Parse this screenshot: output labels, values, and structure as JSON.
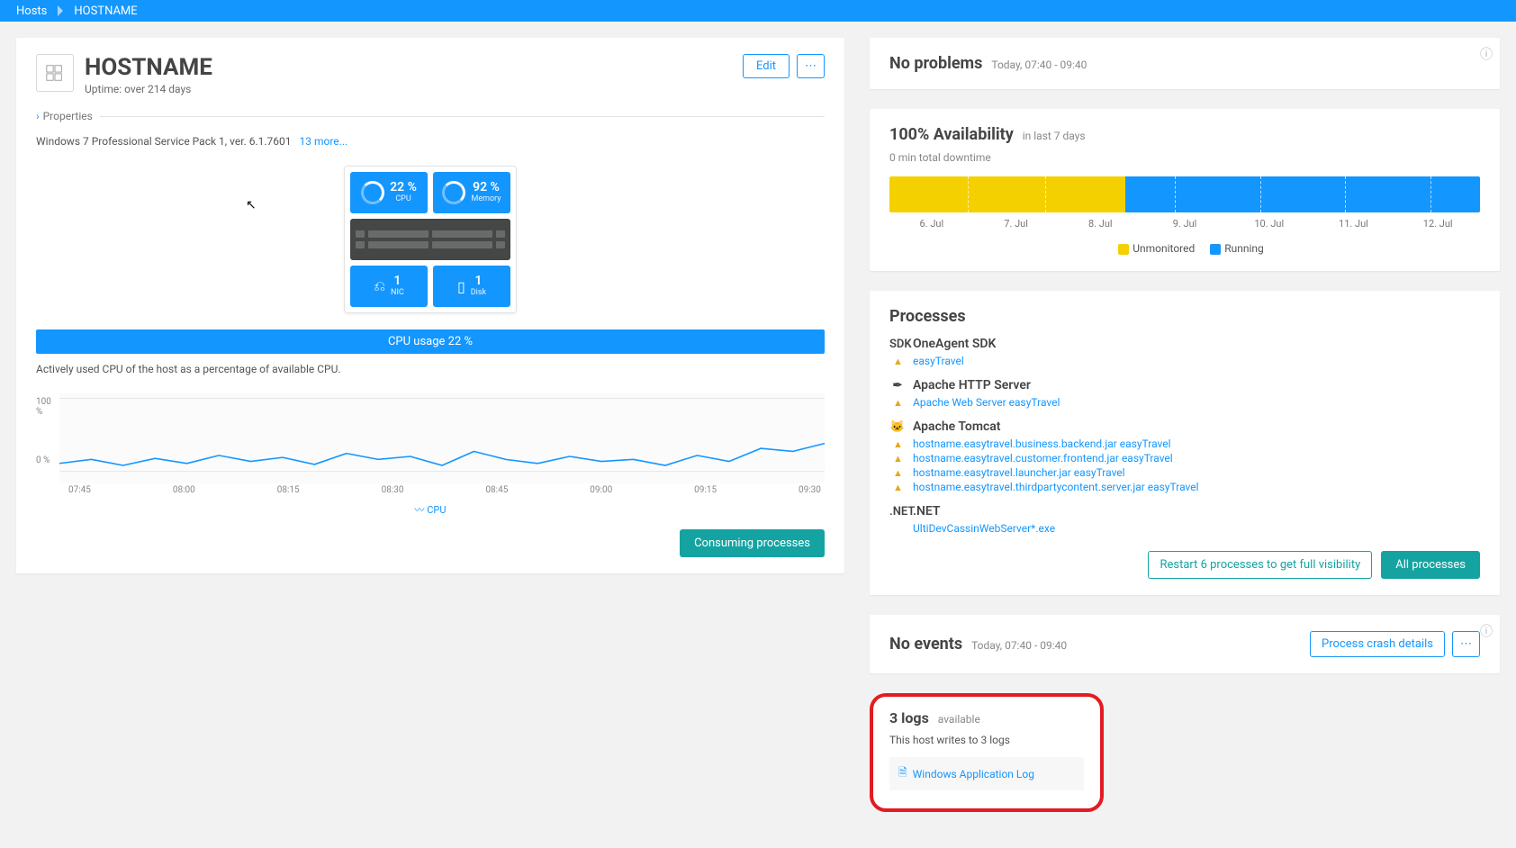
{
  "breadcrumb": {
    "root": "Hosts",
    "current": "HOSTNAME"
  },
  "host": {
    "name": "HOSTNAME",
    "uptime": "Uptime: over 214 days",
    "edit": "Edit",
    "more": "⋯",
    "properties_label": "Properties",
    "os": "Windows 7 Professional Service Pack 1, ver. 6.1.7601",
    "os_more": "13 more..."
  },
  "tiles": {
    "cpu_val": "22 %",
    "cpu_lab": "CPU",
    "mem_val": "92 %",
    "mem_lab": "Memory",
    "nic_val": "1",
    "nic_lab": "NIC",
    "disk_val": "1",
    "disk_lab": "Disk"
  },
  "cpu_panel": {
    "bar": "CPU usage 22 %",
    "desc": "Actively used CPU of the host as a percentage of available CPU.",
    "y100": "100 %",
    "y0": "0 %",
    "legend": "CPU",
    "button": "Consuming processes",
    "xticks": [
      "07:45",
      "08:00",
      "08:15",
      "08:30",
      "08:45",
      "09:00",
      "09:15",
      "09:30"
    ]
  },
  "problems": {
    "title": "No problems",
    "range": "Today, 07:40 - 09:40"
  },
  "availability": {
    "title": "100% Availability",
    "range": "in last 7 days",
    "downtime": "0 min total downtime",
    "dates": [
      "6. Jul",
      "7. Jul",
      "8. Jul",
      "9. Jul",
      "10. Jul",
      "11. Jul",
      "12. Jul"
    ],
    "legend_unmon": "Unmonitored",
    "legend_run": "Running"
  },
  "processes": {
    "title": "Processes",
    "groups": [
      {
        "icon": "SDK",
        "name": "OneAgent SDK",
        "items": [
          {
            "warn": true,
            "label": "easyTravel"
          }
        ]
      },
      {
        "icon": "✒",
        "name": "Apache HTTP Server",
        "items": [
          {
            "warn": true,
            "label": "Apache Web Server easyTravel"
          }
        ]
      },
      {
        "icon": "🐱",
        "name": "Apache Tomcat",
        "items": [
          {
            "warn": true,
            "label": "hostname.easytravel.business.backend.jar easyTravel"
          },
          {
            "warn": true,
            "label": "hostname.easytravel.customer.frontend.jar easyTravel"
          },
          {
            "warn": true,
            "label": "hostname.easytravel.launcher.jar easyTravel"
          },
          {
            "warn": true,
            "label": "hostname.easytravel.thirdpartycontent.server.jar easyTravel"
          }
        ]
      },
      {
        "icon": ".NET",
        "name": ".NET",
        "items": [
          {
            "warn": false,
            "label": "UltiDevCassinWebServer*.exe"
          }
        ]
      }
    ],
    "restart_btn": "Restart 6 processes to get full visibility",
    "all_btn": "All processes"
  },
  "events": {
    "title": "No events",
    "range": "Today, 07:40 - 09:40",
    "crash_btn": "Process crash details",
    "more": "⋯"
  },
  "logs": {
    "title": "3 logs",
    "sub": "available",
    "desc": "This host writes to 3 logs",
    "item1": "Windows Application Log"
  },
  "chart_data": {
    "type": "line",
    "title": "CPU usage",
    "ylabel": "CPU %",
    "ylim": [
      0,
      100
    ],
    "x": [
      "07:45",
      "08:00",
      "08:15",
      "08:30",
      "08:45",
      "09:00",
      "09:15",
      "09:30"
    ],
    "series": [
      {
        "name": "CPU",
        "values": [
          12,
          15,
          14,
          18,
          17,
          13,
          14,
          22
        ]
      }
    ]
  }
}
